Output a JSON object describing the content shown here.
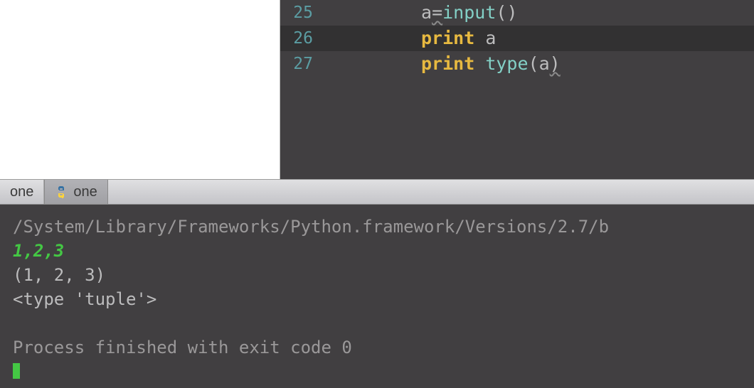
{
  "editor": {
    "lines": [
      {
        "num": "25",
        "highlighted": false,
        "tokens": [
          {
            "cls": "tk-var",
            "text": "a"
          },
          {
            "cls": "tk-op squiggle",
            "text": "="
          },
          {
            "cls": "tk-builtin",
            "text": "input"
          },
          {
            "cls": "tk-paren",
            "text": "()"
          }
        ]
      },
      {
        "num": "26",
        "highlighted": true,
        "tokens": [
          {
            "cls": "tk-keyword",
            "text": "print"
          },
          {
            "cls": "",
            "text": " "
          },
          {
            "cls": "tk-var",
            "text": "a"
          }
        ]
      },
      {
        "num": "27",
        "highlighted": false,
        "tokens": [
          {
            "cls": "tk-keyword",
            "text": "print"
          },
          {
            "cls": "",
            "text": " "
          },
          {
            "cls": "tk-func",
            "text": "type"
          },
          {
            "cls": "tk-paren",
            "text": "("
          },
          {
            "cls": "tk-var",
            "text": "a"
          },
          {
            "cls": "tk-paren squiggle",
            "text": ")"
          }
        ]
      }
    ]
  },
  "tabs": {
    "items": [
      {
        "label": "one",
        "active": false,
        "icon": false
      },
      {
        "label": "one",
        "active": true,
        "icon": true
      }
    ]
  },
  "console": {
    "path": "/System/Library/Frameworks/Python.framework/Versions/2.7/b",
    "user_input": "1,2,3",
    "out1": "(1, 2, 3)",
    "out2": "<type 'tuple'>",
    "exit_msg": "Process finished with exit code 0"
  },
  "colors": {
    "editor_bg": "#413f41",
    "gutter": "#5b9da3",
    "keyword": "#e7b940",
    "builtin": "#83d0c6",
    "text": "#bcbcbd",
    "console_input": "#44c744"
  }
}
